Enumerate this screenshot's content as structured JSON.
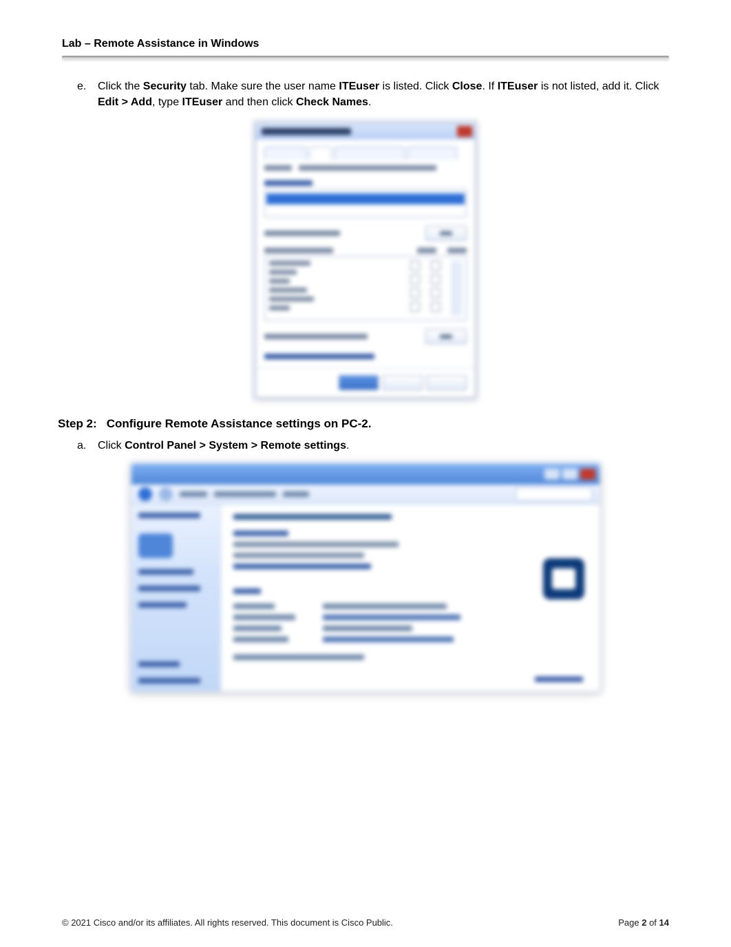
{
  "header": {
    "lab_title": "Lab – Remote Assistance in Windows"
  },
  "step_e": {
    "marker": "e.",
    "t1": "Click the ",
    "b1": "Security",
    "t2": " tab. Make sure the user name ",
    "b2": "ITEuser",
    "t3": " is listed. Click ",
    "b3": "Close",
    "t4": ". If ",
    "b4": "ITEuser",
    "t5": " is not listed, add it. Click ",
    "b5": "Edit > Add",
    "t6": ", type ",
    "b6": "ITEuser",
    "t7": " and then click ",
    "b7": "Check Names",
    "t8": "."
  },
  "step2": {
    "label": "Step 2:",
    "title": "Configure Remote Assistance settings on PC-2."
  },
  "step_a": {
    "marker": "a.",
    "t1": "Click ",
    "b1": "Control Panel > System > Remote settings",
    "t2": "."
  },
  "footer": {
    "copyright": "© 2021 Cisco and/or its affiliates. All rights reserved. This document is Cisco Public.",
    "page_pre": "Page ",
    "page_cur": "2",
    "page_mid": " of ",
    "page_total": "14"
  }
}
